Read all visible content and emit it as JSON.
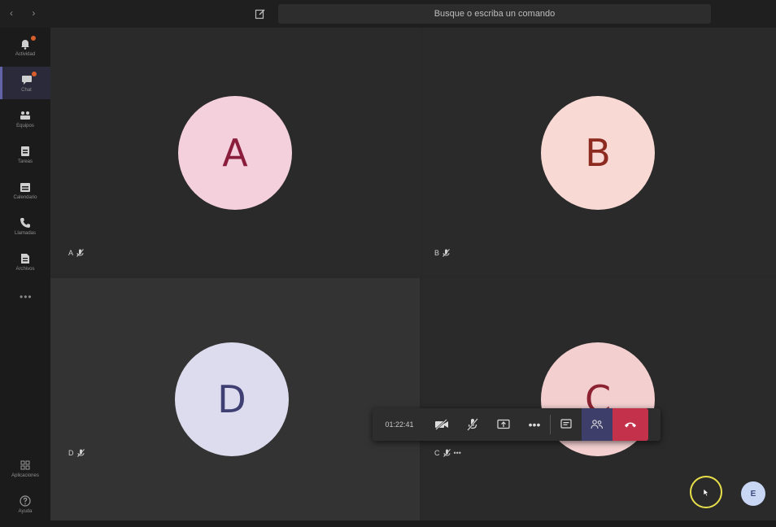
{
  "topbar": {
    "nav": "‹ ›",
    "search_placeholder": "Busque o escriba un comando"
  },
  "rail": {
    "items": [
      {
        "label": "Actividad",
        "icon": "bell-icon"
      },
      {
        "label": "Chat",
        "icon": "chat-icon"
      },
      {
        "label": "Equipos",
        "icon": "teams-icon"
      },
      {
        "label": "Tareas",
        "icon": "tasks-icon"
      },
      {
        "label": "Calendario",
        "icon": "calendar-icon"
      },
      {
        "label": "Llamadas",
        "icon": "phone-icon"
      },
      {
        "label": "Archivos",
        "icon": "files-icon"
      }
    ],
    "more": "•••",
    "bottom": [
      {
        "label": "Aplicaciones",
        "icon": "apps-icon"
      },
      {
        "label": "Ayuda",
        "icon": "help-icon"
      }
    ]
  },
  "tiles": [
    {
      "initial": "A",
      "name": "A",
      "bg": "#f4d0dd",
      "fg": "#8a1c3c"
    },
    {
      "initial": "B",
      "name": "B",
      "bg": "#f8d9d3",
      "fg": "#8e2b21"
    },
    {
      "initial": "D",
      "name": "D",
      "bg": "#dcdcee",
      "fg": "#3f3f74"
    },
    {
      "initial": "C",
      "name": "C",
      "bg": "#f3cfd0",
      "fg": "#8c2231"
    }
  ],
  "toolbar": {
    "timer": "01:22:41"
  },
  "self": {
    "initial": "E"
  },
  "colors": {
    "accent": "#6264a7",
    "hangup": "#c4314b",
    "highlight": "#e8e04a"
  }
}
